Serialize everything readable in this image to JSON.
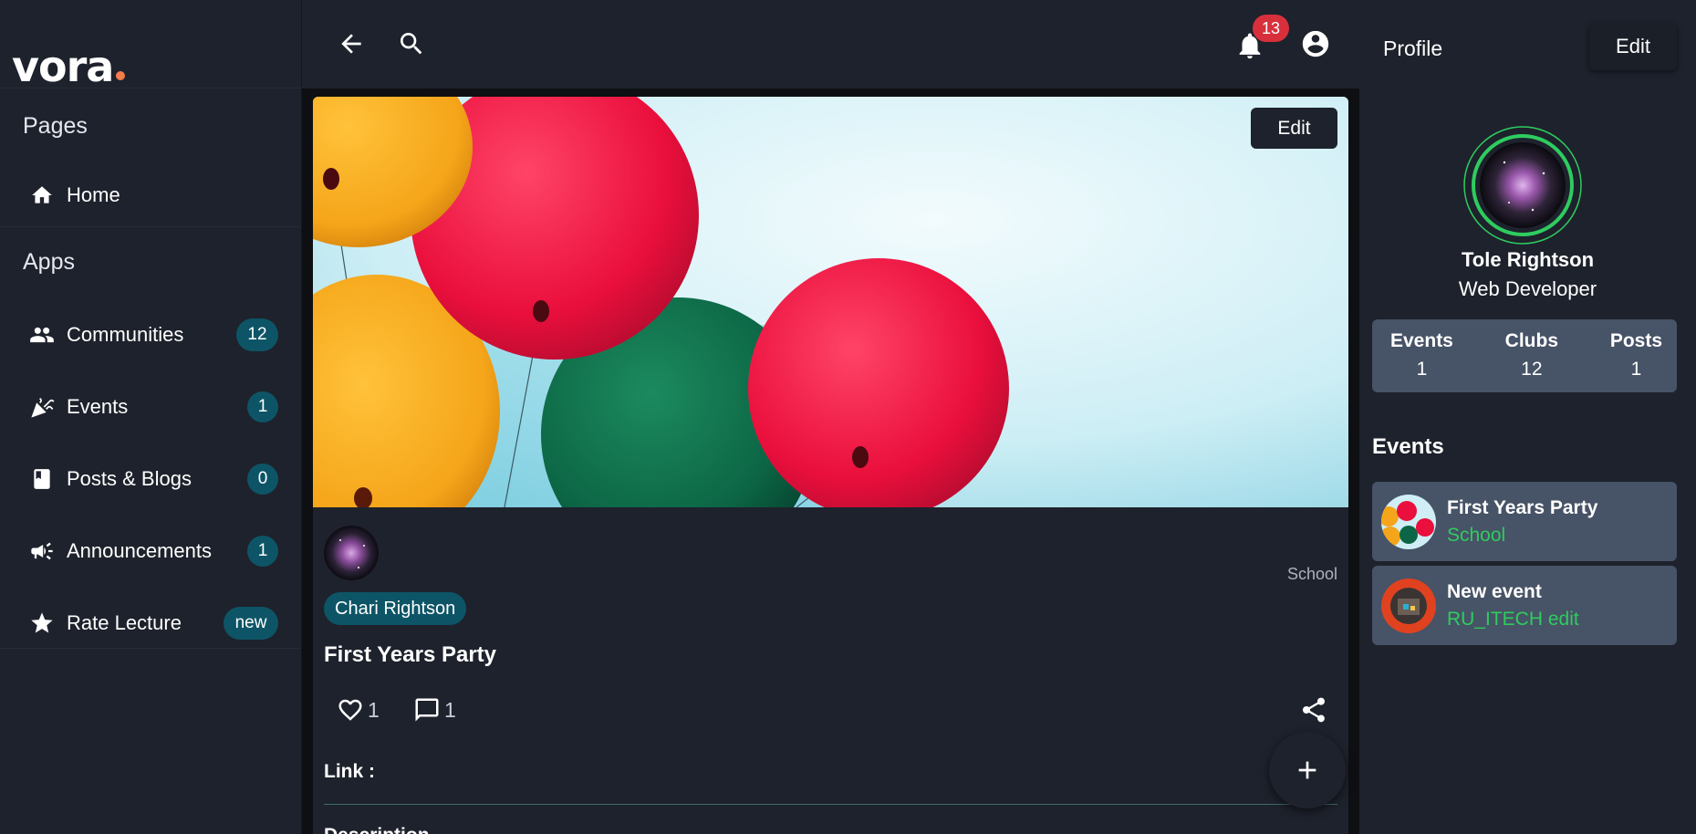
{
  "app": {
    "logo": "vora"
  },
  "sidebar": {
    "pages_title": "Pages",
    "home_label": "Home",
    "apps_title": "Apps",
    "items": [
      {
        "label": "Communities",
        "badge": "12",
        "icon": "people-icon"
      },
      {
        "label": "Events",
        "badge": "1",
        "icon": "celebration-icon"
      },
      {
        "label": "Posts & Blogs",
        "badge": "0",
        "icon": "book-icon"
      },
      {
        "label": "Announcements",
        "badge": "1",
        "icon": "megaphone-icon"
      },
      {
        "label": "Rate Lecture",
        "badge": "new",
        "icon": "star-icon"
      }
    ]
  },
  "topbar": {
    "notification_count": "13"
  },
  "post": {
    "cover_edit_label": "Edit",
    "category": "School",
    "author": "Chari Rightson",
    "title": "First Years Party",
    "likes": "1",
    "comments": "1",
    "link_label": "Link :",
    "description_label": "Description"
  },
  "profile": {
    "title": "Profile",
    "edit_label": "Edit",
    "name": "Tole Rightson",
    "role": "Web Developer",
    "stats": [
      {
        "label": "Events",
        "value": "1"
      },
      {
        "label": "Clubs",
        "value": "12"
      },
      {
        "label": "Posts",
        "value": "1"
      }
    ],
    "events_title": "Events",
    "events": [
      {
        "name": "First Years Party",
        "sub": "School"
      },
      {
        "name": "New event",
        "sub": "RU_ITECH edit"
      }
    ]
  },
  "colors": {
    "accent_teal": "#0d5566",
    "accent_green": "#2ecc5f",
    "notif_red": "#d7303c",
    "logo_dot": "#f47b4a"
  }
}
